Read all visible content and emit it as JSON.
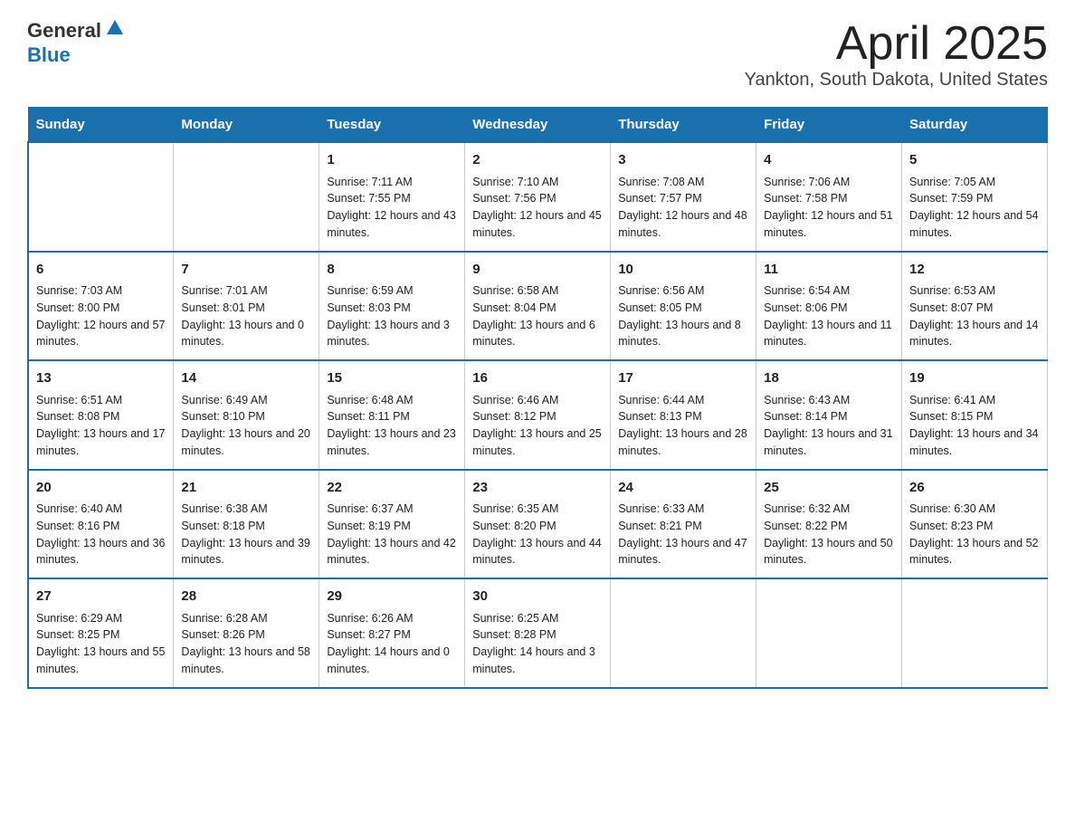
{
  "logo": {
    "general": "General",
    "arrow": "▲",
    "blue": "Blue"
  },
  "title": "April 2025",
  "subtitle": "Yankton, South Dakota, United States",
  "days": [
    "Sunday",
    "Monday",
    "Tuesday",
    "Wednesday",
    "Thursday",
    "Friday",
    "Saturday"
  ],
  "weeks": [
    [
      {
        "num": "",
        "sunrise": "",
        "sunset": "",
        "daylight": ""
      },
      {
        "num": "",
        "sunrise": "",
        "sunset": "",
        "daylight": ""
      },
      {
        "num": "1",
        "sunrise": "Sunrise: 7:11 AM",
        "sunset": "Sunset: 7:55 PM",
        "daylight": "Daylight: 12 hours and 43 minutes."
      },
      {
        "num": "2",
        "sunrise": "Sunrise: 7:10 AM",
        "sunset": "Sunset: 7:56 PM",
        "daylight": "Daylight: 12 hours and 45 minutes."
      },
      {
        "num": "3",
        "sunrise": "Sunrise: 7:08 AM",
        "sunset": "Sunset: 7:57 PM",
        "daylight": "Daylight: 12 hours and 48 minutes."
      },
      {
        "num": "4",
        "sunrise": "Sunrise: 7:06 AM",
        "sunset": "Sunset: 7:58 PM",
        "daylight": "Daylight: 12 hours and 51 minutes."
      },
      {
        "num": "5",
        "sunrise": "Sunrise: 7:05 AM",
        "sunset": "Sunset: 7:59 PM",
        "daylight": "Daylight: 12 hours and 54 minutes."
      }
    ],
    [
      {
        "num": "6",
        "sunrise": "Sunrise: 7:03 AM",
        "sunset": "Sunset: 8:00 PM",
        "daylight": "Daylight: 12 hours and 57 minutes."
      },
      {
        "num": "7",
        "sunrise": "Sunrise: 7:01 AM",
        "sunset": "Sunset: 8:01 PM",
        "daylight": "Daylight: 13 hours and 0 minutes."
      },
      {
        "num": "8",
        "sunrise": "Sunrise: 6:59 AM",
        "sunset": "Sunset: 8:03 PM",
        "daylight": "Daylight: 13 hours and 3 minutes."
      },
      {
        "num": "9",
        "sunrise": "Sunrise: 6:58 AM",
        "sunset": "Sunset: 8:04 PM",
        "daylight": "Daylight: 13 hours and 6 minutes."
      },
      {
        "num": "10",
        "sunrise": "Sunrise: 6:56 AM",
        "sunset": "Sunset: 8:05 PM",
        "daylight": "Daylight: 13 hours and 8 minutes."
      },
      {
        "num": "11",
        "sunrise": "Sunrise: 6:54 AM",
        "sunset": "Sunset: 8:06 PM",
        "daylight": "Daylight: 13 hours and 11 minutes."
      },
      {
        "num": "12",
        "sunrise": "Sunrise: 6:53 AM",
        "sunset": "Sunset: 8:07 PM",
        "daylight": "Daylight: 13 hours and 14 minutes."
      }
    ],
    [
      {
        "num": "13",
        "sunrise": "Sunrise: 6:51 AM",
        "sunset": "Sunset: 8:08 PM",
        "daylight": "Daylight: 13 hours and 17 minutes."
      },
      {
        "num": "14",
        "sunrise": "Sunrise: 6:49 AM",
        "sunset": "Sunset: 8:10 PM",
        "daylight": "Daylight: 13 hours and 20 minutes."
      },
      {
        "num": "15",
        "sunrise": "Sunrise: 6:48 AM",
        "sunset": "Sunset: 8:11 PM",
        "daylight": "Daylight: 13 hours and 23 minutes."
      },
      {
        "num": "16",
        "sunrise": "Sunrise: 6:46 AM",
        "sunset": "Sunset: 8:12 PM",
        "daylight": "Daylight: 13 hours and 25 minutes."
      },
      {
        "num": "17",
        "sunrise": "Sunrise: 6:44 AM",
        "sunset": "Sunset: 8:13 PM",
        "daylight": "Daylight: 13 hours and 28 minutes."
      },
      {
        "num": "18",
        "sunrise": "Sunrise: 6:43 AM",
        "sunset": "Sunset: 8:14 PM",
        "daylight": "Daylight: 13 hours and 31 minutes."
      },
      {
        "num": "19",
        "sunrise": "Sunrise: 6:41 AM",
        "sunset": "Sunset: 8:15 PM",
        "daylight": "Daylight: 13 hours and 34 minutes."
      }
    ],
    [
      {
        "num": "20",
        "sunrise": "Sunrise: 6:40 AM",
        "sunset": "Sunset: 8:16 PM",
        "daylight": "Daylight: 13 hours and 36 minutes."
      },
      {
        "num": "21",
        "sunrise": "Sunrise: 6:38 AM",
        "sunset": "Sunset: 8:18 PM",
        "daylight": "Daylight: 13 hours and 39 minutes."
      },
      {
        "num": "22",
        "sunrise": "Sunrise: 6:37 AM",
        "sunset": "Sunset: 8:19 PM",
        "daylight": "Daylight: 13 hours and 42 minutes."
      },
      {
        "num": "23",
        "sunrise": "Sunrise: 6:35 AM",
        "sunset": "Sunset: 8:20 PM",
        "daylight": "Daylight: 13 hours and 44 minutes."
      },
      {
        "num": "24",
        "sunrise": "Sunrise: 6:33 AM",
        "sunset": "Sunset: 8:21 PM",
        "daylight": "Daylight: 13 hours and 47 minutes."
      },
      {
        "num": "25",
        "sunrise": "Sunrise: 6:32 AM",
        "sunset": "Sunset: 8:22 PM",
        "daylight": "Daylight: 13 hours and 50 minutes."
      },
      {
        "num": "26",
        "sunrise": "Sunrise: 6:30 AM",
        "sunset": "Sunset: 8:23 PM",
        "daylight": "Daylight: 13 hours and 52 minutes."
      }
    ],
    [
      {
        "num": "27",
        "sunrise": "Sunrise: 6:29 AM",
        "sunset": "Sunset: 8:25 PM",
        "daylight": "Daylight: 13 hours and 55 minutes."
      },
      {
        "num": "28",
        "sunrise": "Sunrise: 6:28 AM",
        "sunset": "Sunset: 8:26 PM",
        "daylight": "Daylight: 13 hours and 58 minutes."
      },
      {
        "num": "29",
        "sunrise": "Sunrise: 6:26 AM",
        "sunset": "Sunset: 8:27 PM",
        "daylight": "Daylight: 14 hours and 0 minutes."
      },
      {
        "num": "30",
        "sunrise": "Sunrise: 6:25 AM",
        "sunset": "Sunset: 8:28 PM",
        "daylight": "Daylight: 14 hours and 3 minutes."
      },
      {
        "num": "",
        "sunrise": "",
        "sunset": "",
        "daylight": ""
      },
      {
        "num": "",
        "sunrise": "",
        "sunset": "",
        "daylight": ""
      },
      {
        "num": "",
        "sunrise": "",
        "sunset": "",
        "daylight": ""
      }
    ]
  ]
}
